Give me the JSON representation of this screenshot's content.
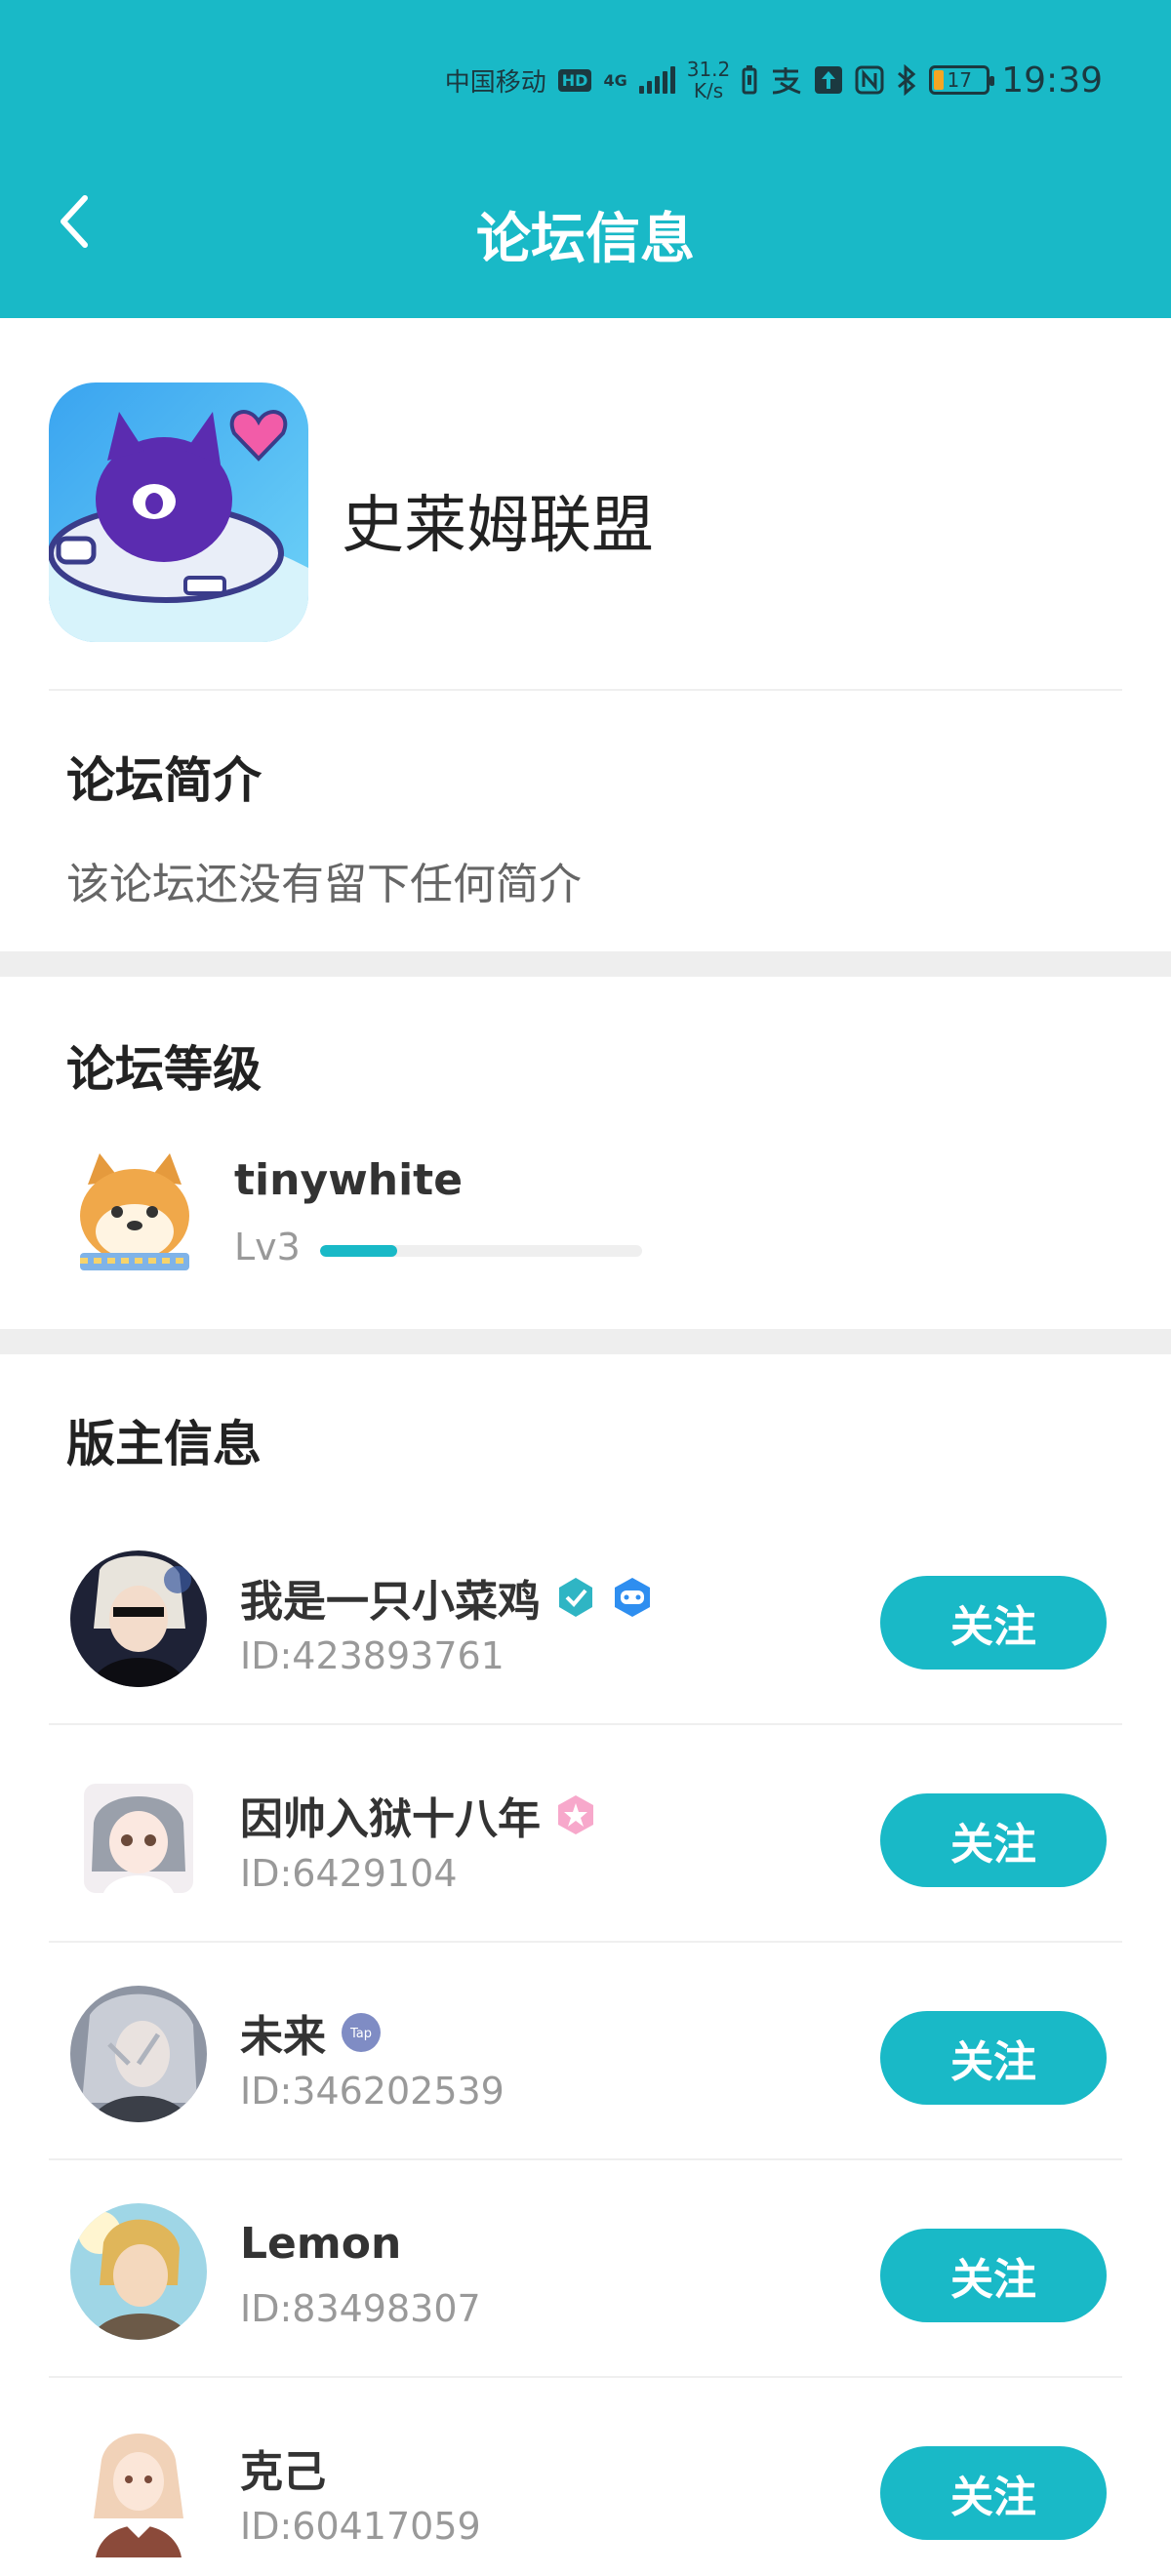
{
  "status_bar": {
    "carrier": "中国移动",
    "hd": "HD",
    "network": "4G",
    "net_speed_value": "31.2",
    "net_speed_unit": "K/s",
    "battery": "17",
    "time": "19:39",
    "icons": [
      "hd-icon",
      "signal-icon",
      "battery-saver-icon",
      "alipay-icon",
      "upload-icon",
      "nfc-icon",
      "bluetooth-icon",
      "battery-icon"
    ]
  },
  "nav": {
    "title": "论坛信息"
  },
  "forum": {
    "name": "史莱姆联盟"
  },
  "intro": {
    "title": "论坛简介",
    "text": "该论坛还没有留下任何简介"
  },
  "level": {
    "title": "论坛等级",
    "user_name": "tinywhite",
    "level_label": "Lv3",
    "progress": 0.24
  },
  "moderators": {
    "title": "版主信息",
    "follow_label": "关注",
    "items": [
      {
        "name": "我是一只小菜鸡",
        "id": "ID:423893761",
        "badges": [
          "verified-badge-icon",
          "game-badge-icon"
        ]
      },
      {
        "name": "因帅入狱十八年",
        "id": "ID:6429104",
        "badges": [
          "pink-star-badge-icon"
        ]
      },
      {
        "name": "未来",
        "id": "ID:346202539",
        "badges": [
          "tap-badge-icon"
        ]
      },
      {
        "name": "Lemon",
        "id": "ID:83498307",
        "badges": []
      },
      {
        "name": "克己",
        "id": "ID:60417059",
        "badges": []
      }
    ]
  },
  "colors": {
    "accent": "#19b9c7",
    "divider": "#eeeeee"
  }
}
